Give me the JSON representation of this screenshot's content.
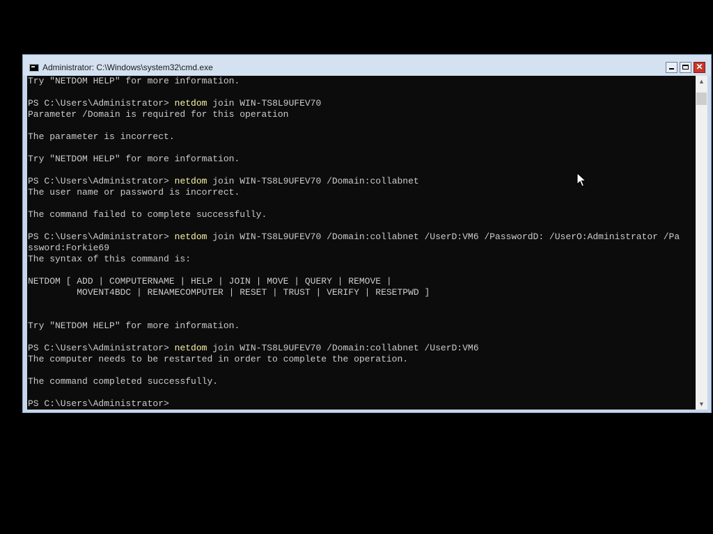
{
  "window": {
    "title": "Administrator: C:\\Windows\\system32\\cmd.exe",
    "buttons": {
      "minimize_icon": "minimize-icon",
      "maximize_icon": "maximize-icon",
      "close_icon": "close-icon",
      "close_glyph": "✕"
    }
  },
  "colors": {
    "console_bg": "#0c0c0c",
    "console_fg": "#cccccc",
    "command_fg": "#f9f1a5",
    "titlebar_bg": "#d3e1f0",
    "close_bg": "#c9362c"
  },
  "console": {
    "lines": [
      {
        "text": "Try \"NETDOM HELP\" for more information."
      },
      {
        "text": ""
      },
      {
        "prompt": "PS C:\\Users\\Administrator> ",
        "command": "netdom",
        "args": " join WIN-TS8L9UFEV70"
      },
      {
        "text": "Parameter /Domain is required for this operation"
      },
      {
        "text": ""
      },
      {
        "text": "The parameter is incorrect."
      },
      {
        "text": ""
      },
      {
        "text": "Try \"NETDOM HELP\" for more information."
      },
      {
        "text": ""
      },
      {
        "prompt": "PS C:\\Users\\Administrator> ",
        "command": "netdom",
        "args": " join WIN-TS8L9UFEV70 /Domain:collabnet"
      },
      {
        "text": "The user name or password is incorrect."
      },
      {
        "text": ""
      },
      {
        "text": "The command failed to complete successfully."
      },
      {
        "text": ""
      },
      {
        "prompt": "PS C:\\Users\\Administrator> ",
        "command": "netdom",
        "args": " join WIN-TS8L9UFEV70 /Domain:collabnet /UserD:VM6 /PasswordD: /UserO:Administrator /Pa"
      },
      {
        "text": "ssword:Forkie69"
      },
      {
        "text": "The syntax of this command is:"
      },
      {
        "text": ""
      },
      {
        "text": "NETDOM [ ADD | COMPUTERNAME | HELP | JOIN | MOVE | QUERY | REMOVE |"
      },
      {
        "text": "         MOVENT4BDC | RENAMECOMPUTER | RESET | TRUST | VERIFY | RESETPWD ]"
      },
      {
        "text": ""
      },
      {
        "text": ""
      },
      {
        "text": "Try \"NETDOM HELP\" for more information."
      },
      {
        "text": ""
      },
      {
        "prompt": "PS C:\\Users\\Administrator> ",
        "command": "netdom",
        "args": " join WIN-TS8L9UFEV70 /Domain:collabnet /UserD:VM6"
      },
      {
        "text": "The computer needs to be restarted in order to complete the operation."
      },
      {
        "text": ""
      },
      {
        "text": "The command completed successfully."
      },
      {
        "text": ""
      },
      {
        "prompt": "PS C:\\Users\\Administrator> ",
        "command": "",
        "args": ""
      }
    ]
  },
  "scrollbar": {
    "up_icon": "scroll-up-arrow-icon",
    "down_icon": "scroll-down-arrow-icon",
    "up_glyph": "▲",
    "down_glyph": "▼"
  },
  "pointer": {
    "icon": "mouse-cursor-icon"
  }
}
